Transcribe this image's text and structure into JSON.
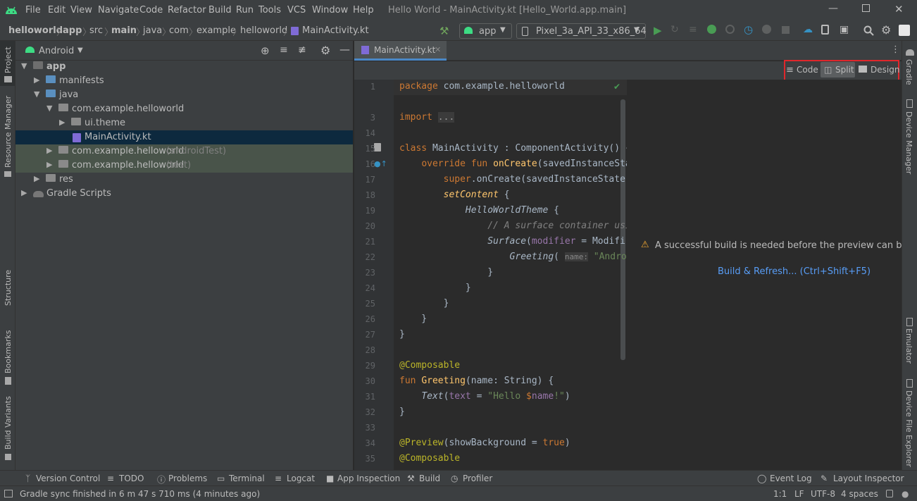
{
  "window": {
    "title": "Hello World - MainActivity.kt [Hello_World.app.main]",
    "menu": [
      "File",
      "Edit",
      "View",
      "Navigate",
      "Code",
      "Refactor",
      "Build",
      "Run",
      "Tools",
      "VCS",
      "Window",
      "Help"
    ]
  },
  "breadcrumbs": [
    "helloworld",
    "app",
    "src",
    "main",
    "java",
    "com",
    "example",
    "helloworld",
    "MainActivity.kt"
  ],
  "toolbar": {
    "run_config": "app",
    "device": "Pixel_3a_API_33_x86_64"
  },
  "left_strip": [
    "Project",
    "Resource Manager",
    "Structure",
    "Bookmarks",
    "Build Variants"
  ],
  "right_strip": [
    "Gradle",
    "Device Manager",
    "Emulator",
    "Device File Explorer"
  ],
  "project_panel": {
    "view_mode": "Android",
    "tree": [
      {
        "label": "app",
        "indent": 0,
        "bold": true,
        "expanded": true
      },
      {
        "label": "manifests",
        "indent": 1,
        "expanded": false
      },
      {
        "label": "java",
        "indent": 1,
        "expanded": true
      },
      {
        "label": "com.example.helloworld",
        "indent": 2,
        "expanded": true
      },
      {
        "label": "ui.theme",
        "indent": 3,
        "expanded": false
      },
      {
        "label": "MainActivity.kt",
        "indent": 4,
        "selected": true
      },
      {
        "label": "com.example.helloworld",
        "suffix": "(androidTest)",
        "indent": 2,
        "expanded": false,
        "tinted": true
      },
      {
        "label": "com.example.helloworld",
        "suffix": "(test)",
        "indent": 2,
        "expanded": false,
        "tinted": true
      },
      {
        "label": "res",
        "indent": 1,
        "expanded": false
      },
      {
        "label": "Gradle Scripts",
        "indent": 0,
        "expanded": false
      }
    ]
  },
  "editor": {
    "tab": "MainActivity.kt",
    "view_modes": {
      "code": "Code",
      "split": "Split",
      "design": "Design",
      "active": "Split"
    },
    "line_numbers": [
      "1",
      "3",
      "14",
      "15",
      "16",
      "17",
      "18",
      "19",
      "20",
      "21",
      "22",
      "23",
      "24",
      "25",
      "26",
      "27",
      "28",
      "29",
      "30",
      "31",
      "32",
      "33",
      "34",
      "35"
    ],
    "preview_warning": "A successful build is needed before the preview can be displayed",
    "preview_link": "Build & Refresh... (Ctrl+Shift+F5)"
  },
  "bottom_tools": [
    "Version Control",
    "TODO",
    "Problems",
    "Terminal",
    "Logcat",
    "App Inspection",
    "Build",
    "Profiler"
  ],
  "bottom_tools_right": [
    "Event Log",
    "Layout Inspector"
  ],
  "status": {
    "message": "Gradle sync finished in 6 m 47 s 710 ms (4 minutes ago)",
    "position": "1:1",
    "line_sep": "LF",
    "encoding": "UTF-8",
    "indent": "4 spaces"
  },
  "colors": {
    "accent": "#4a88c7",
    "highlight_box": "#e0262b",
    "selection": "#0d293e",
    "link": "#589df6",
    "warning": "#f0a732",
    "android_green": "#3ddc84"
  }
}
